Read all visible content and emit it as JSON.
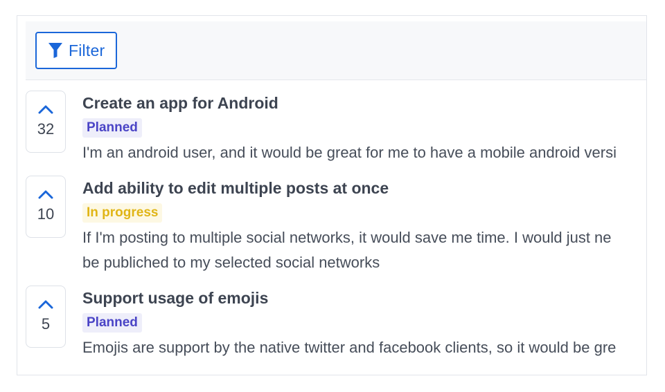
{
  "toolbar": {
    "filter_label": "Filter",
    "filter_icon": "filter-funnel-icon",
    "accent_color": "#1a66d9"
  },
  "posts": [
    {
      "votes": "32",
      "title": "Create an app for Android",
      "status": "Planned",
      "description": [
        "I'm an android user, and it would be great for me to have a mobile android versi"
      ]
    },
    {
      "votes": "10",
      "title": "Add ability to edit multiple posts at once",
      "status": "In progress",
      "description": [
        "If I'm posting to multiple social networks, it would save me time. I would just ne",
        "be publiched to my selected social networks"
      ]
    },
    {
      "votes": "5",
      "title": "Support usage of emojis",
      "status": "Planned",
      "description": [
        "Emojis are support by the native twitter and facebook clients, so it would be gre"
      ]
    }
  ],
  "status_colors": {
    "planned_text": "#4a44c6",
    "planned_bg": "#eeeefa",
    "in_progress_text": "#e0b516",
    "in_progress_bg": "#fdf8e3"
  }
}
